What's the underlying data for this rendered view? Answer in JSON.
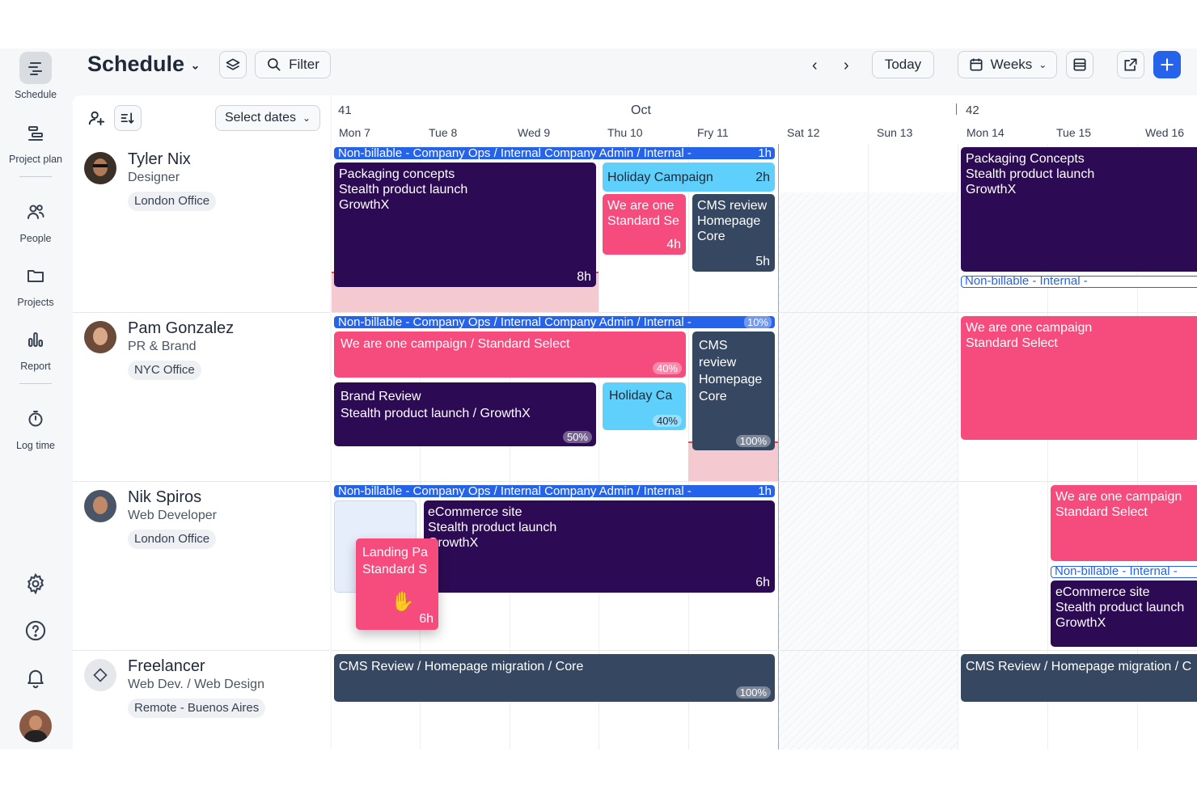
{
  "nav": {
    "items": [
      {
        "label": "Schedule",
        "icon": "schedule-icon"
      },
      {
        "label": "Project plan",
        "icon": "project-plan-icon"
      },
      {
        "label": "People",
        "icon": "people-icon"
      },
      {
        "label": "Projects",
        "icon": "folder-icon"
      },
      {
        "label": "Report",
        "icon": "report-icon"
      },
      {
        "label": "Log time",
        "icon": "stopwatch-icon"
      }
    ],
    "bottom_icons": [
      "gear-icon",
      "help-icon",
      "bell-icon",
      "user-avatar"
    ]
  },
  "header": {
    "title": "Schedule",
    "filter_label": "Filter",
    "today_label": "Today",
    "weeks_label": "Weeks",
    "select_dates_label": "Select dates"
  },
  "calendar": {
    "month": "Oct",
    "week_numbers": [
      "41",
      "42"
    ],
    "days": [
      "Mon 7",
      "Tue 8",
      "Wed 9",
      "Thu 10",
      "Fry 11",
      "Sat 12",
      "Sun 13",
      "Mon 14",
      "Tue 15",
      "Wed 16"
    ]
  },
  "people": [
    {
      "name": "Tyler Nix",
      "role": "Designer",
      "office": "London Office"
    },
    {
      "name": "Pam Gonzalez",
      "role": "PR & Brand",
      "office": "NYC Office"
    },
    {
      "name": "Nik Spiros",
      "role": "Web Developer",
      "office": "London Office"
    },
    {
      "name": "Freelancer",
      "role": "Web Dev. / Web Design",
      "office": "Remote - Buenos Aires"
    }
  ],
  "tasks": {
    "nonbill_long": "Non-billable - Company Ops / Internal Company Admin / Internal -",
    "nonbill_short": "Non-billable - Internal -",
    "r1_nonbill_hours": "1h",
    "r1_packaging_1": "Packaging concepts",
    "r1_packaging_2": "Stealth product launch",
    "r1_packaging_3": "GrowthX",
    "r1_packaging_hours": "8h",
    "r1_holiday": "Holiday Campaign",
    "r1_holiday_hours": "2h",
    "r1_weare_1": "We are one",
    "r1_weare_2": "Standard Se",
    "r1_weare_hours": "4h",
    "r1_cms_1": "CMS review",
    "r1_cms_2": "Homepage",
    "r1_cms_3": "Core",
    "r1_cms_hours": "5h",
    "r1_w2_packaging_1": "Packaging Concepts",
    "r1_w2_packaging_2": "Stealth product launch",
    "r1_w2_packaging_3": "GrowthX",
    "r2_nonbill_pct": "10%",
    "r2_weare": "We are one campaign / Standard Select",
    "r2_weare_pct": "40%",
    "r2_brand_1": "Brand Review",
    "r2_brand_2": "Stealth product launch / GrowthX",
    "r2_brand_pct": "50%",
    "r2_holiday": "Holiday Ca",
    "r2_holiday_pct": "40%",
    "r2_cms_1": "CMS review",
    "r2_cms_2": "Homepage",
    "r2_cms_3": "Core",
    "r2_cms_pct": "100%",
    "r2_w2_weare_1": "We are one campaign",
    "r2_w2_weare_2": "Standard Select",
    "r3_nonbill_hours": "1h",
    "r3_ecom_1": "eCommerce site",
    "r3_ecom_2": "Stealth product launch",
    "r3_ecom_3": "GrowthX",
    "r3_ecom_hours": "6h",
    "r3_landing_1": "Landing Pa",
    "r3_landing_2": "Standard S",
    "r3_landing_hours": "6h",
    "r3_w2_weare_1": "We are one campaign",
    "r3_w2_weare_2": "Standard Select",
    "r3_w2_ecom_1": "eCommerce site",
    "r3_w2_ecom_2": "Stealth product launch",
    "r3_w2_ecom_3": "GrowthX",
    "r4_cms": "CMS Review / Homepage migration / Core",
    "r4_cms_pct": "100%",
    "r4_w2_cms": "CMS Review / Homepage migration / C"
  },
  "colors": {
    "accent": "#2563eb",
    "task_dark": "#2c0b54",
    "task_pink": "#f54b7d",
    "task_cyan": "#5fd0fb",
    "task_slate": "#364761",
    "overtime": "#f4c9cf"
  }
}
